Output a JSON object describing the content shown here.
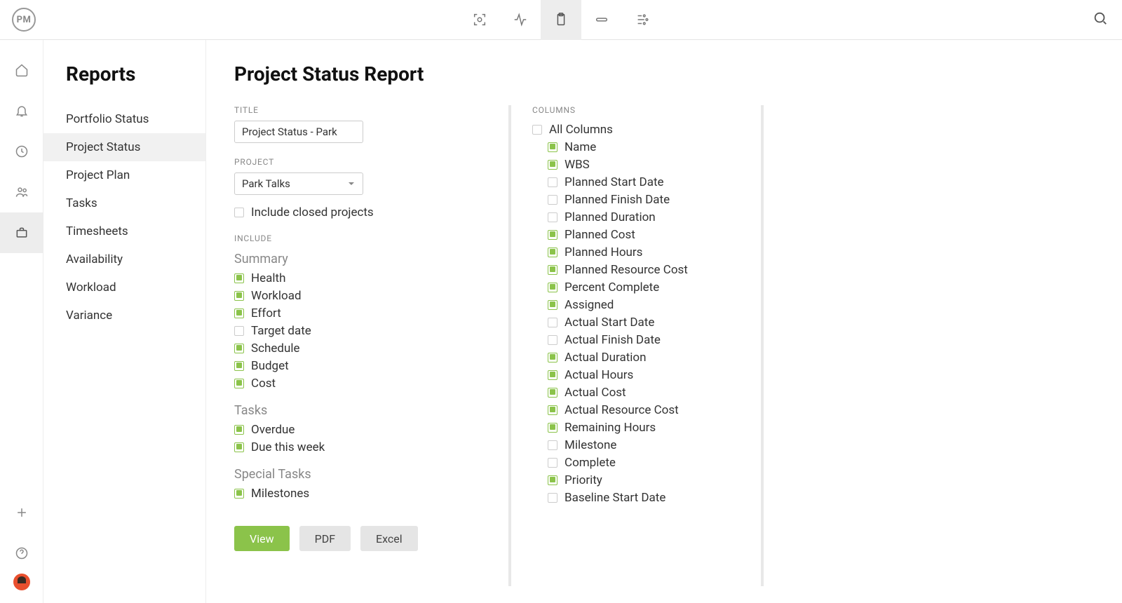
{
  "logo_text": "PM",
  "sidebar_title": "Reports",
  "sidebar_items": [
    "Portfolio Status",
    "Project Status",
    "Project Plan",
    "Tasks",
    "Timesheets",
    "Availability",
    "Workload",
    "Variance"
  ],
  "sidebar_active": 1,
  "page_title": "Project Status Report",
  "title_label": "TITLE",
  "title_value": "Project Status - Park",
  "project_label": "PROJECT",
  "project_value": "Park Talks",
  "include_closed": {
    "label": "Include closed projects",
    "checked": false
  },
  "include_label": "INCLUDE",
  "include_groups": [
    {
      "name": "Summary",
      "items": [
        {
          "label": "Health",
          "checked": true
        },
        {
          "label": "Workload",
          "checked": true
        },
        {
          "label": "Effort",
          "checked": true
        },
        {
          "label": "Target date",
          "checked": false
        },
        {
          "label": "Schedule",
          "checked": true
        },
        {
          "label": "Budget",
          "checked": true
        },
        {
          "label": "Cost",
          "checked": true
        }
      ]
    },
    {
      "name": "Tasks",
      "items": [
        {
          "label": "Overdue",
          "checked": true
        },
        {
          "label": "Due this week",
          "checked": true
        }
      ]
    },
    {
      "name": "Special Tasks",
      "items": [
        {
          "label": "Milestones",
          "checked": true
        }
      ]
    }
  ],
  "columns_label": "COLUMNS",
  "all_columns": {
    "label": "All Columns",
    "checked": false
  },
  "columns": [
    {
      "label": "Name",
      "checked": true
    },
    {
      "label": "WBS",
      "checked": true
    },
    {
      "label": "Planned Start Date",
      "checked": false
    },
    {
      "label": "Planned Finish Date",
      "checked": false
    },
    {
      "label": "Planned Duration",
      "checked": false
    },
    {
      "label": "Planned Cost",
      "checked": true
    },
    {
      "label": "Planned Hours",
      "checked": true
    },
    {
      "label": "Planned Resource Cost",
      "checked": true
    },
    {
      "label": "Percent Complete",
      "checked": true
    },
    {
      "label": "Assigned",
      "checked": true
    },
    {
      "label": "Actual Start Date",
      "checked": false
    },
    {
      "label": "Actual Finish Date",
      "checked": false
    },
    {
      "label": "Actual Duration",
      "checked": true
    },
    {
      "label": "Actual Hours",
      "checked": true
    },
    {
      "label": "Actual Cost",
      "checked": true
    },
    {
      "label": "Actual Resource Cost",
      "checked": true
    },
    {
      "label": "Remaining Hours",
      "checked": true
    },
    {
      "label": "Milestone",
      "checked": false
    },
    {
      "label": "Complete",
      "checked": false
    },
    {
      "label": "Priority",
      "checked": true
    },
    {
      "label": "Baseline Start Date",
      "checked": false
    }
  ],
  "buttons": {
    "view": "View",
    "pdf": "PDF",
    "excel": "Excel"
  }
}
